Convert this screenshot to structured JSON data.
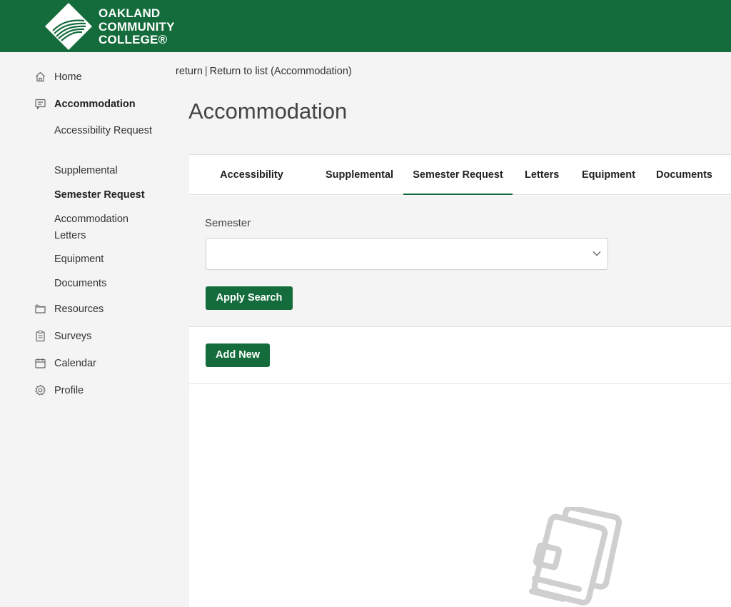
{
  "brand": {
    "line1": "OAKLAND",
    "line2": "COMMUNITY",
    "line3": "COLLEGE®",
    "color": "#146c3c"
  },
  "sidebar": {
    "items": [
      {
        "label": "Home",
        "icon": "home-icon"
      },
      {
        "label": "Accommodation",
        "icon": "message-icon",
        "active": true
      },
      {
        "label": "Resources",
        "icon": "folder-icon"
      },
      {
        "label": "Surveys",
        "icon": "clipboard-icon"
      },
      {
        "label": "Calendar",
        "icon": "calendar-icon"
      },
      {
        "label": "Profile",
        "icon": "gear-icon"
      }
    ],
    "sub_items": [
      {
        "label": "Accessibility Request"
      },
      {
        "label": "Supplemental"
      },
      {
        "label": "Semester Request",
        "active": true
      },
      {
        "label": "Accommodation Letters"
      },
      {
        "label": "Equipment"
      },
      {
        "label": "Documents"
      }
    ]
  },
  "breadcrumb": {
    "return_label": "return",
    "separator": "|",
    "list_label": "Return to list (Accommodation)"
  },
  "page": {
    "title": "Accommodation"
  },
  "tabs": [
    {
      "label": "Accessibility Request"
    },
    {
      "label": "Supplemental"
    },
    {
      "label": "Semester Request",
      "active": true
    },
    {
      "label": "Letters"
    },
    {
      "label": "Equipment"
    },
    {
      "label": "Documents"
    }
  ],
  "search": {
    "semester_label": "Semester",
    "semester_value": "",
    "apply_label": "Apply Search"
  },
  "actions": {
    "add_new_label": "Add New"
  },
  "empty_state": {
    "icon": "documents-icon"
  }
}
